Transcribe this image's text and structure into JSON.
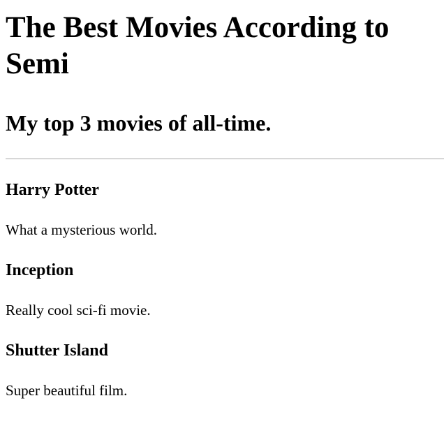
{
  "page": {
    "title": "The Best Movies According to Semi",
    "subtitle": "My top 3 movies of all-time."
  },
  "movies": [
    {
      "title": "Harry Potter",
      "description": "What a mysterious world."
    },
    {
      "title": "Inception",
      "description": "Really cool sci-fi movie."
    },
    {
      "title": "Shutter Island",
      "description": "Super beautiful film."
    }
  ]
}
